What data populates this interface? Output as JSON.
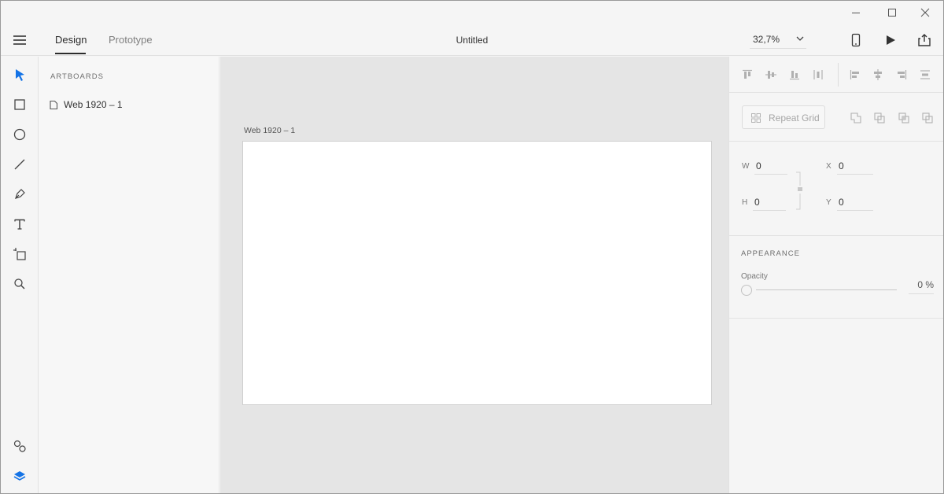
{
  "window": {
    "controls": [
      {
        "name": "minimize",
        "icon": "minimize-icon"
      },
      {
        "name": "maximize",
        "icon": "maximize-icon"
      },
      {
        "name": "close",
        "icon": "close-icon"
      }
    ]
  },
  "header": {
    "tabs": [
      {
        "label": "Design",
        "active": true
      },
      {
        "label": "Prototype",
        "active": false
      }
    ],
    "document_title": "Untitled",
    "zoom": "32,7%",
    "icons": [
      "mobile-preview-icon",
      "play-icon",
      "share-icon"
    ]
  },
  "toolbar": {
    "tools": [
      "select",
      "rectangle",
      "ellipse",
      "line",
      "pen",
      "text",
      "artboard",
      "zoom"
    ],
    "bottom": [
      "assets",
      "layers"
    ],
    "accent_color": "#1473e6"
  },
  "layers": {
    "heading": "ARTBOARDS",
    "items": [
      {
        "label": "Web 1920 – 1",
        "icon": "page-icon"
      }
    ]
  },
  "canvas": {
    "artboard_label": "Web 1920 – 1"
  },
  "inspector": {
    "align_icons": [
      "align-top-icon",
      "align-middle-icon",
      "align-bottom-icon",
      "distribute-horizontal-icon",
      "align-left-icon",
      "align-center-icon",
      "align-right-icon",
      "distribute-vertical-icon"
    ],
    "repeat_grid_label": "Repeat Grid",
    "boolean_icons": [
      "add-icon",
      "subtract-icon",
      "intersect-icon",
      "exclude-icon"
    ],
    "dimensions": {
      "w_label": "W",
      "w_value": "0",
      "h_label": "H",
      "h_value": "0",
      "x_label": "X",
      "x_value": "0",
      "y_label": "Y",
      "y_value": "0"
    },
    "appearance": {
      "heading": "APPEARANCE",
      "opacity_label": "Opacity",
      "opacity_value": "0 %"
    }
  }
}
